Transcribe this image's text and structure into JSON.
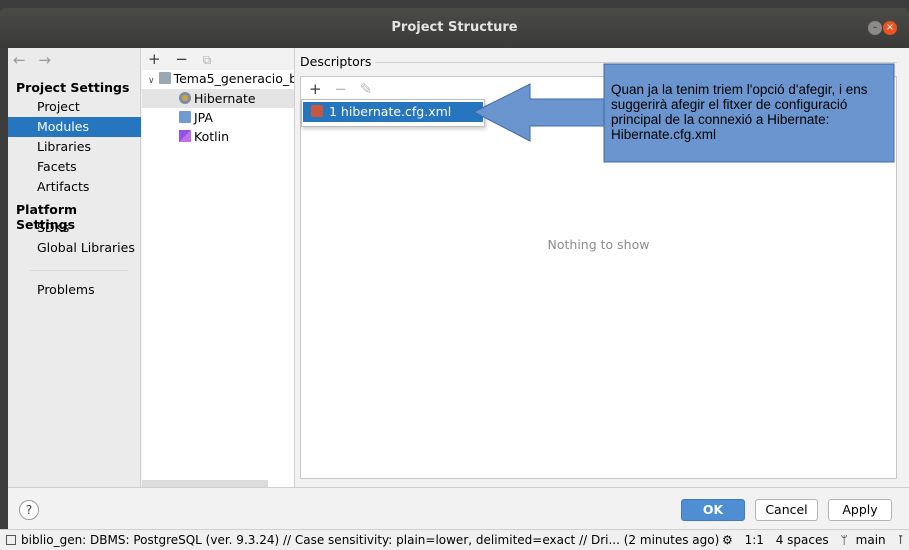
{
  "window": {
    "title": "Project Structure",
    "minimize_glyph": "–",
    "close_glyph": "×"
  },
  "nav": {
    "back": "←",
    "forward": "→"
  },
  "sidebar": {
    "project_settings": "Project Settings",
    "project_items": [
      "Project",
      "Modules",
      "Libraries",
      "Facets",
      "Artifacts"
    ],
    "platform_settings": "Platform Settings",
    "platform_items": [
      "SDKs",
      "Global Libraries"
    ],
    "problems": "Problems",
    "selected": "Modules"
  },
  "modules_tree": {
    "toolbar": {
      "add": "+",
      "remove": "−",
      "copy": "⧉"
    },
    "root": "Tema5_generacio_b",
    "children": [
      "Hibernate",
      "JPA",
      "Kotlin"
    ],
    "selected": "Hibernate"
  },
  "descriptors": {
    "label": "Descriptors",
    "toolbar": {
      "add": "+",
      "remove": "−",
      "edit": "✎"
    },
    "empty_text": "Nothing to show",
    "popup_item": "1 hibernate.cfg.xml"
  },
  "callout": {
    "text": "Quan ja la tenim triem l'opció d'afegir, i ens suggerirà afegir el fitxer de configuració principal de la connexió a Hibernate: Hibernate.cfg.xml",
    "fill": "#6a95cf",
    "stroke": "#3f6aa3"
  },
  "footer": {
    "help": "?",
    "ok": "OK",
    "cancel": "Cancel",
    "apply": "Apply"
  },
  "statusbar": {
    "text": "biblio_gen: DBMS: PostgreSQL (ver. 9.3.24) // Case sensitivity: plain=lower, delimited=exact // Dri... (2 minutes ago)",
    "position": "1:1",
    "indent": "4 spaces",
    "branch": "main"
  },
  "colors": {
    "selection": "#2675bf",
    "ok_button": "#4d8fd2",
    "close_button": "#e95420"
  }
}
